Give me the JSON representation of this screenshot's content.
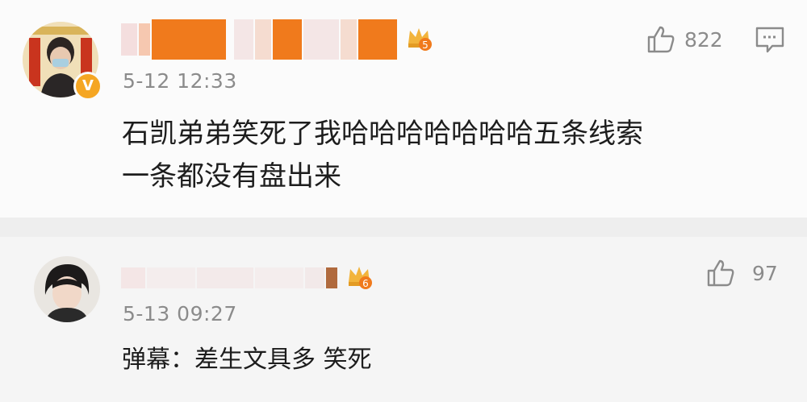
{
  "comments": [
    {
      "time": "5-12 12:33",
      "likes": "822",
      "text_lines": [
        "石凯弟弟笑死了我哈哈哈哈哈哈哈五条线索",
        "一条都没有盘出来"
      ],
      "level_badge": "5",
      "verified_badge": "V",
      "icons": [
        "thumbs-up-icon",
        "comment-icon",
        "crown-level-icon",
        "verified-icon"
      ]
    },
    {
      "time": "5-13 09:27",
      "likes": "97",
      "text_lines": [
        "弹幕：差生文具多 笑死"
      ],
      "level_badge": "6",
      "icons": [
        "thumbs-up-icon",
        "crown-level-icon"
      ]
    }
  ],
  "colors": {
    "orange": "#f07a1c",
    "blurred_pink": "#f4e6e6",
    "gray_text": "#8b8b8b",
    "crown_gold": "#f2b43c"
  }
}
